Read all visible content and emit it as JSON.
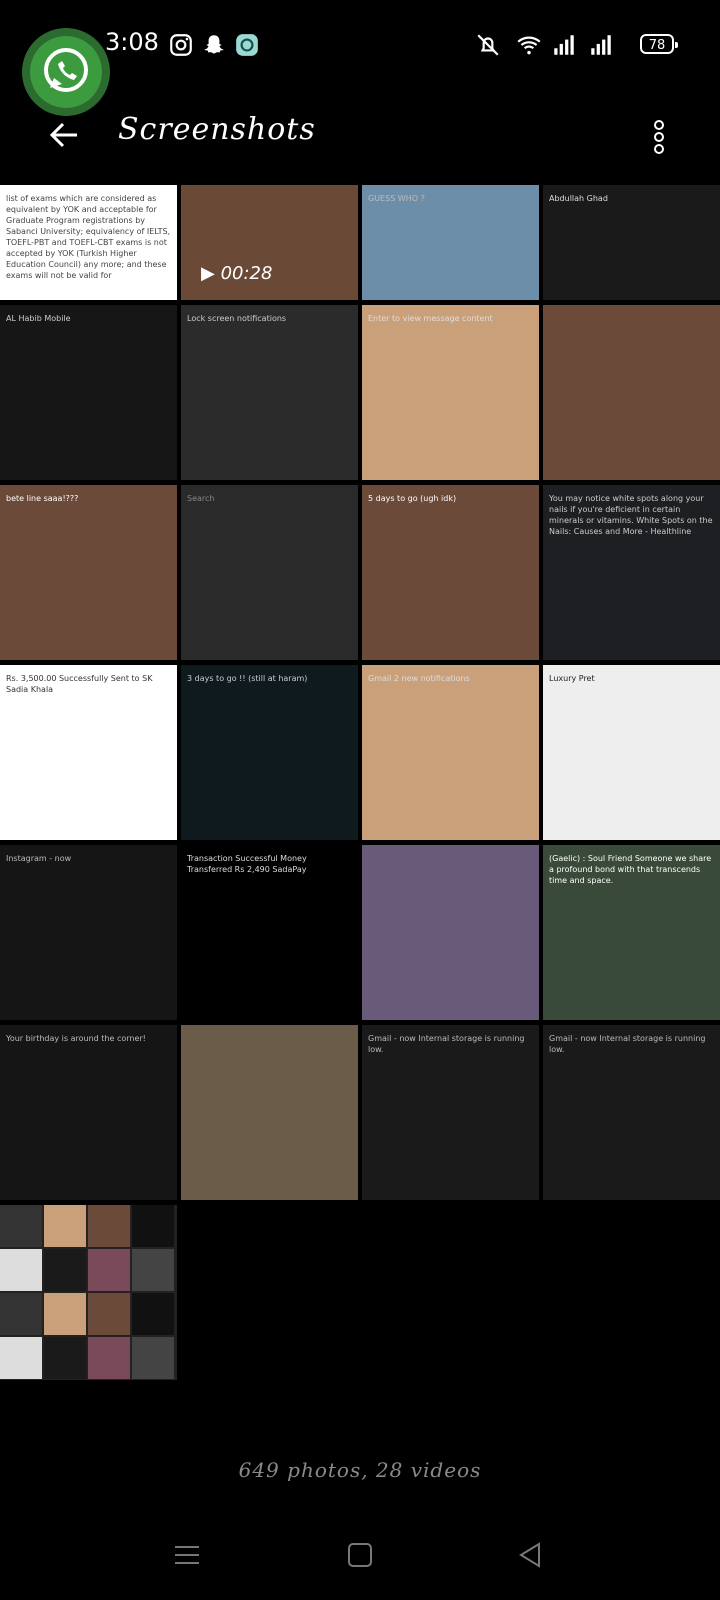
{
  "status_bar": {
    "time": "3:08",
    "battery": "78",
    "icons": [
      "instagram-icon",
      "snapchat-icon",
      "app-icon",
      "mute-icon",
      "wifi-icon",
      "signal-icon",
      "signal-icon-2"
    ]
  },
  "chat_head": {
    "app": "whatsapp-icon"
  },
  "header": {
    "title": "Screenshots",
    "back_icon": "back-arrow-icon",
    "menu_icon": "more-vert-icon"
  },
  "tiles": [
    {
      "caption": "list of exams which are considered as equivalent by YOK and acceptable for Graduate Program registrations by Sabanci University; equivalency of IELTS, TOEFL-PBT and TOEFL-CBT exams is not accepted by YOK (Turkish Higher Education Council) any more; and these exams will not be valid for",
      "bg": "#ffffff",
      "fg": "#444444"
    },
    {
      "caption": "",
      "video_duration": "00:28",
      "bg": "#6a4a36"
    },
    {
      "caption": "GUESS WHO ?",
      "bg": "#6d8ea8"
    },
    {
      "caption": "Abdullah Ghad",
      "bg": "#1a1a1a",
      "fg": "#dddddd"
    },
    {
      "caption": "AL Habib Mobile",
      "bg": "#161616",
      "fg": "#cccccc"
    },
    {
      "caption": "Lock screen notifications",
      "bg": "#2b2b2b",
      "fg": "#cccccc"
    },
    {
      "caption": "Enter to view message content",
      "bg": "#c9a07a",
      "fg": "#dddddd"
    },
    {
      "caption": "",
      "bg": "#6b4a3a"
    },
    {
      "caption": "bete line saaa!???",
      "bg": "#6b4a3a",
      "fg": "#ffffff"
    },
    {
      "caption": "Search",
      "bg": "#2a2a2a",
      "fg": "#888888"
    },
    {
      "caption": "5 days to go (ugh idk)",
      "bg": "#6b4a3a",
      "fg": "#ffffff"
    },
    {
      "caption": "You may notice white spots along your nails if you're deficient in certain minerals or vitamins. White Spots on the Nails: Causes and More - Healthline",
      "bg": "#1e1f22",
      "fg": "#cccccc"
    },
    {
      "caption": "Rs. 3,500.00 Successfully Sent to SK Sadia Khala",
      "bg": "#ffffff",
      "fg": "#333333"
    },
    {
      "caption": "3 days to go !! (still at haram)",
      "bg": "#0e1a1e",
      "fg": "#cccccc"
    },
    {
      "caption": "Gmail 2 new notifications",
      "bg": "#c9a07a",
      "fg": "#dddddd"
    },
    {
      "caption": "Luxury Pret",
      "bg": "#eeeeee",
      "fg": "#222222"
    },
    {
      "caption": "Instagram - now",
      "bg": "#151515",
      "fg": "#bbbbbb"
    },
    {
      "caption": "Transaction Successful Money Transferred Rs 2,490 SadaPay",
      "bg": "#000000",
      "fg": "#dddddd"
    },
    {
      "caption": "",
      "bg": "#6a5a7a"
    },
    {
      "caption": "(Gaelic) : Soul Friend Someone we share a profound bond with that transcends time and space.",
      "bg": "#3a4a3a",
      "fg": "#ffffff"
    },
    {
      "caption": "Your birthday is around the corner!",
      "bg": "#151515",
      "fg": "#bbbbbb"
    },
    {
      "caption": "",
      "bg": "#6b5c4a"
    },
    {
      "caption": "Gmail - now Internal storage is running low.",
      "bg": "#1a1a1a",
      "fg": "#bbbbbb"
    },
    {
      "caption": "Gmail - now Internal storage is running low.",
      "bg": "#1a1a1a",
      "fg": "#bbbbbb"
    },
    {
      "caption": "",
      "bg": "#2a2a2a"
    }
  ],
  "footer": {
    "counts": "649 photos, 28 videos"
  },
  "nav_bar": {
    "menu_icon": "menu-icon",
    "home_icon": "home-square-icon",
    "back_icon": "back-triangle-icon"
  }
}
